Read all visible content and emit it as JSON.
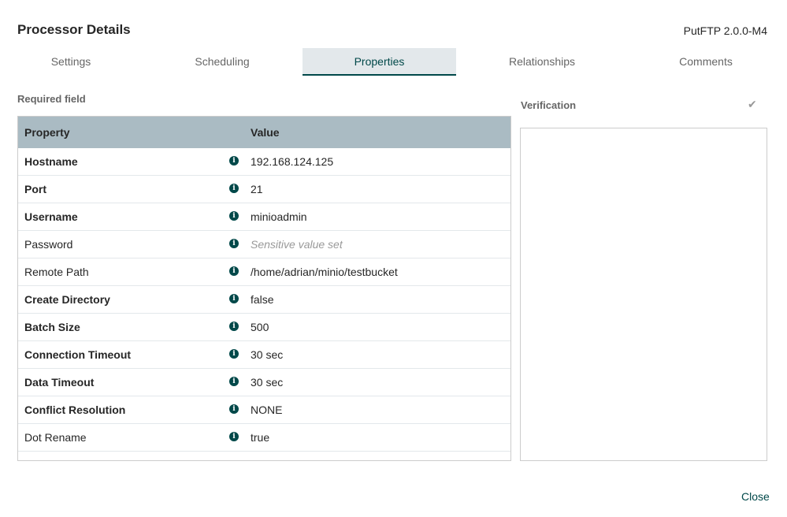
{
  "dialog": {
    "title": "Processor Details",
    "version": "PutFTP 2.0.0-M4",
    "close_label": "Close"
  },
  "tabs": [
    {
      "label": "Settings",
      "active": false
    },
    {
      "label": "Scheduling",
      "active": false
    },
    {
      "label": "Properties",
      "active": true
    },
    {
      "label": "Relationships",
      "active": false
    },
    {
      "label": "Comments",
      "active": false
    }
  ],
  "properties": {
    "required_label": "Required field",
    "columns": {
      "property": "Property",
      "value": "Value"
    },
    "rows": [
      {
        "name": "Hostname",
        "value": "192.168.124.125",
        "required": true,
        "sensitive": false
      },
      {
        "name": "Port",
        "value": "21",
        "required": true,
        "sensitive": false
      },
      {
        "name": "Username",
        "value": "minioadmin",
        "required": true,
        "sensitive": false
      },
      {
        "name": "Password",
        "value": "Sensitive value set",
        "required": false,
        "sensitive": true
      },
      {
        "name": "Remote Path",
        "value": "/home/adrian/minio/testbucket",
        "required": false,
        "sensitive": false
      },
      {
        "name": "Create Directory",
        "value": "false",
        "required": true,
        "sensitive": false
      },
      {
        "name": "Batch Size",
        "value": "500",
        "required": true,
        "sensitive": false
      },
      {
        "name": "Connection Timeout",
        "value": "30 sec",
        "required": true,
        "sensitive": false
      },
      {
        "name": "Data Timeout",
        "value": "30 sec",
        "required": true,
        "sensitive": false
      },
      {
        "name": "Conflict Resolution",
        "value": "NONE",
        "required": true,
        "sensitive": false
      },
      {
        "name": "Dot Rename",
        "value": "true",
        "required": false,
        "sensitive": false
      }
    ],
    "info_icon": "info-circle-icon"
  },
  "verification": {
    "label": "Verification",
    "icon": "check-icon"
  },
  "colors": {
    "accent": "#004849",
    "header_bg": "#aabbc3",
    "active_tab_bg": "#e3e8eb"
  }
}
